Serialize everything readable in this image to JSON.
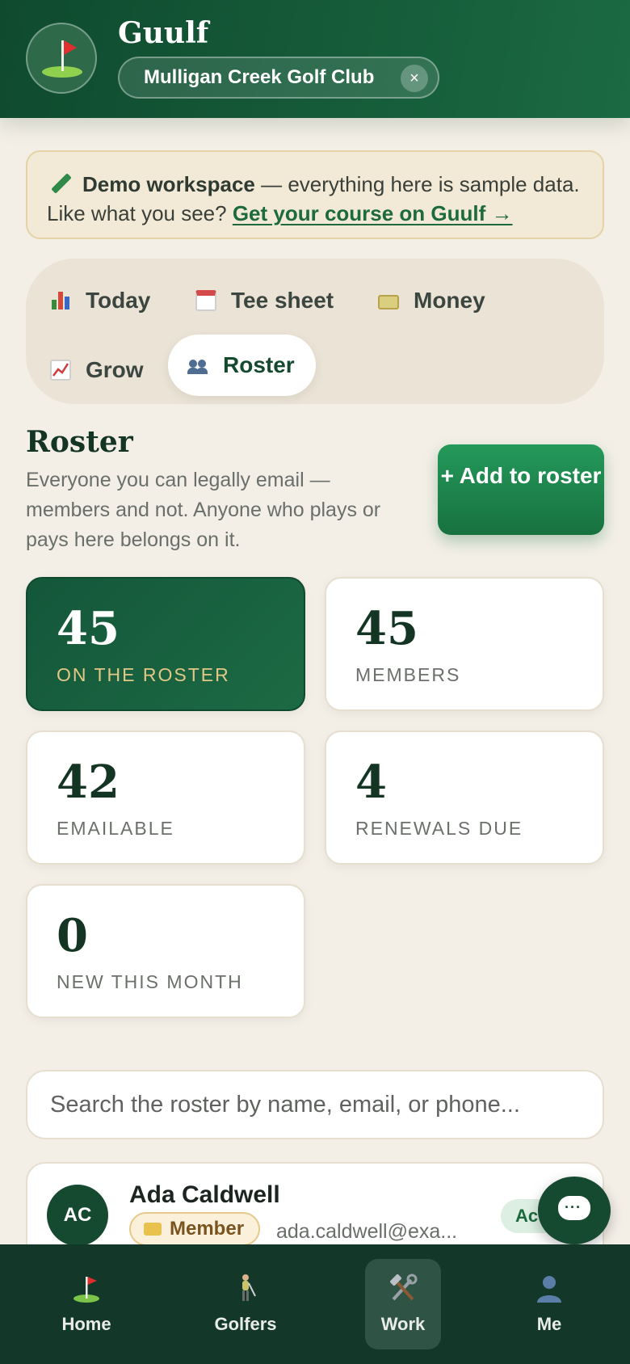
{
  "header": {
    "brand": "Guulf",
    "club": "Mulligan Creek Golf Club",
    "close_glyph": "×",
    "logo_icon": "golf-flag-icon"
  },
  "demo_banner": {
    "bold": "Demo workspace",
    "text": " — everything here is sample data. Like what you see? ",
    "link": "Get your course on Guulf →"
  },
  "tabs": [
    {
      "label": "Today",
      "icon": "bar-chart-icon"
    },
    {
      "label": "Tee sheet",
      "icon": "calendar-icon"
    },
    {
      "label": "Money",
      "icon": "money-icon"
    },
    {
      "label": "Grow",
      "icon": "trend-chart-icon"
    },
    {
      "label": "Roster",
      "icon": "people-icon",
      "active": true
    }
  ],
  "roster": {
    "title": "Roster",
    "description": "Everyone you can legally email — members and not. Anyone who plays or pays here belongs on it.",
    "add_label": "+ Add to roster"
  },
  "stats": [
    {
      "value": "45",
      "label": "ON THE ROSTER"
    },
    {
      "value": "45",
      "label": "MEMBERS"
    },
    {
      "value": "42",
      "label": "EMAILABLE"
    },
    {
      "value": "4",
      "label": "RENEWALS DUE"
    },
    {
      "value": "0",
      "label": "NEW THIS MONTH"
    }
  ],
  "search": {
    "placeholder": "Search the roster by name, email, or phone..."
  },
  "rows": [
    {
      "initials": "AC",
      "name": "Ada Caldwell",
      "badge": "Member",
      "email": "ada.caldwell@exa...",
      "status": "Active"
    }
  ],
  "nav": [
    {
      "label": "Home",
      "icon": "golf-flag-icon"
    },
    {
      "label": "Golfers",
      "icon": "golfer-icon"
    },
    {
      "label": "Work",
      "icon": "tools-icon",
      "active": true
    },
    {
      "label": "Me",
      "icon": "user-icon"
    }
  ],
  "colors": {
    "brand_green": "#154a30",
    "accent_green": "#1c6a3d",
    "gold": "#e2c785",
    "background": "#f3efe7"
  }
}
